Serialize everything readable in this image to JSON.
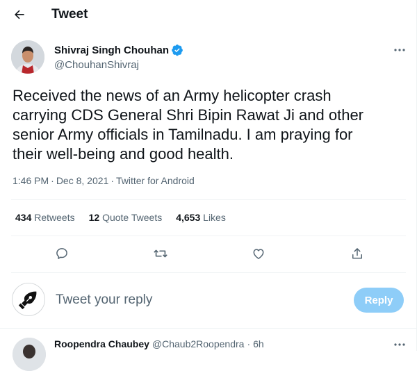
{
  "header": {
    "title": "Tweet"
  },
  "tweet": {
    "author_name": "Shivraj Singh Chouhan",
    "author_handle": "@ChouhanShivraj",
    "text": "Received the news of an Army helicopter crash\ncarrying CDS General Shri Bipin Rawat Ji and other\nsenior Army officials in Tamilnadu. I am praying for\ntheir well-being and good health.",
    "time": "1:46 PM",
    "date": "Dec 8, 2021",
    "source": "Twitter for Android",
    "separator": "·",
    "retweets_count": "434",
    "retweets_label": "Retweets",
    "quotes_count": "12",
    "quotes_label": "Quote Tweets",
    "likes_count": "4,653",
    "likes_label": "Likes"
  },
  "reply": {
    "placeholder": "Tweet your reply",
    "button_label": "Reply"
  },
  "next_reply": {
    "name": "Roopendra Chaubey",
    "handle": "@Chaub2Roopendra",
    "separator": "·",
    "time": "6h"
  },
  "icons": {
    "back": "arrow-left-icon",
    "verified": "verified-badge-icon",
    "more": "more-horizontal-icon",
    "reply": "comment-icon",
    "retweet": "retweet-icon",
    "like": "heart-icon",
    "share": "share-icon"
  },
  "colors": {
    "accent": "#1d9bf0",
    "reply_button": "#8ecdf8",
    "secondary_text": "#536471",
    "divider": "#eff3f4"
  }
}
